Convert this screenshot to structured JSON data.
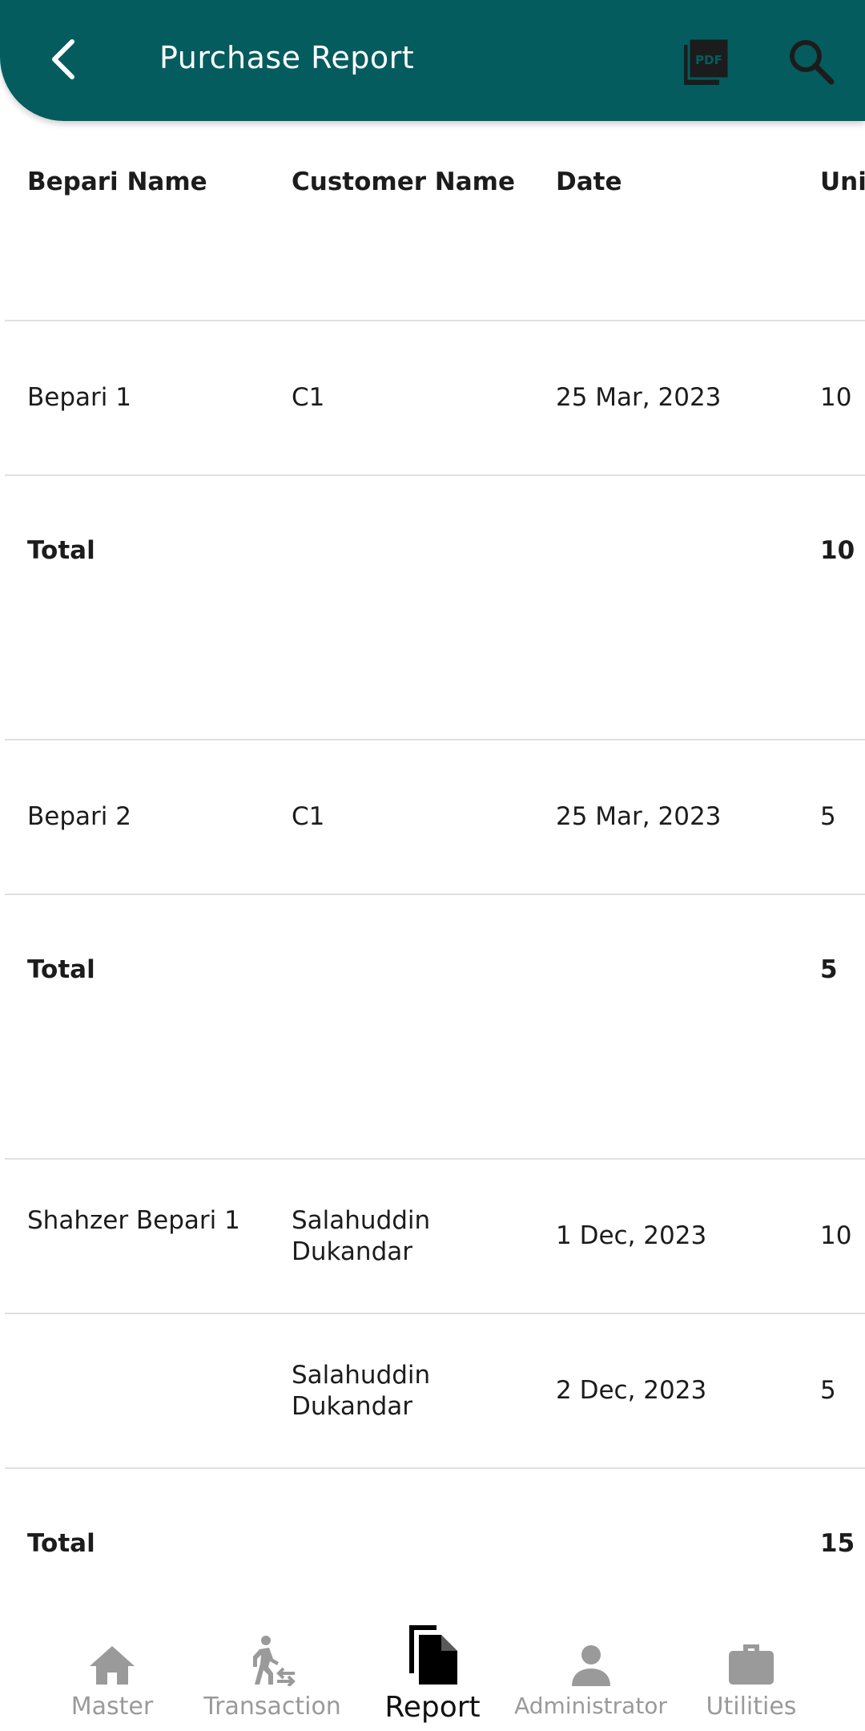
{
  "appbar": {
    "title": "Purchase Report",
    "back_icon": "back-arrow-icon",
    "pdf_icon": "pdf-icon",
    "search_icon": "search-icon",
    "color": "#045c5f"
  },
  "table": {
    "headers": [
      "Bepari Name",
      "Customer Name",
      "Date",
      "Uni"
    ],
    "rows": [
      {
        "bepari": "Bepari 1",
        "customer": "C1",
        "date": "25 Mar, 2023",
        "units": "10"
      },
      {
        "total_label": "Total",
        "total": "10"
      },
      {
        "bepari": "Bepari 2",
        "customer": "C1",
        "date": "25 Mar, 2023",
        "units": "5"
      },
      {
        "total_label": "Total",
        "total": "5"
      },
      {
        "bepari": "Shahzer Bepari 1",
        "customer": "Salahuddin Dukandar",
        "date": "1 Dec, 2023",
        "units": "10"
      },
      {
        "bepari": "",
        "customer": "Salahuddin Dukandar",
        "date": "2 Dec, 2023",
        "units": "5"
      },
      {
        "total_label": "Total",
        "total": "15"
      }
    ]
  },
  "bottom_nav": {
    "items": [
      {
        "label": "Master",
        "icon": "home-icon"
      },
      {
        "label": "Transaction",
        "icon": "transaction-icon"
      },
      {
        "label": "Report",
        "icon": "report-icon",
        "active": true
      },
      {
        "label": "Administrator",
        "icon": "person-icon"
      },
      {
        "label": "Utilities",
        "icon": "briefcase-icon"
      }
    ]
  }
}
